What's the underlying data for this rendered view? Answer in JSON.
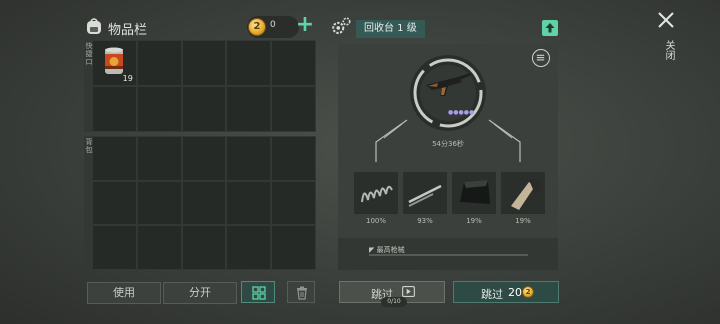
{
  "inventory": {
    "title": "物品栏",
    "coin_balance": "0",
    "coin_symbol": "2",
    "quick_slot_label": "快捷口",
    "backpack_label": "背包",
    "slot_item": {
      "name": "canned food",
      "count": "19"
    }
  },
  "actions": {
    "use_label": "使用",
    "split_label": "分开"
  },
  "recycler": {
    "title": "回收台 1 级",
    "timer": "54分36秒",
    "materials": [
      {
        "name": "spring",
        "percent": "100%"
      },
      {
        "name": "metal-rod",
        "percent": "93%"
      },
      {
        "name": "metal-plate",
        "percent": "19%"
      },
      {
        "name": "wood-handle",
        "percent": "19%"
      }
    ],
    "progress_label": "最高枪械",
    "progress": 0
  },
  "skip": {
    "ad_label": "跳过",
    "ad_counter": "0/10",
    "pay_label": "跳过",
    "pay_cost": "20"
  },
  "close": {
    "label": "关闭"
  },
  "colors": {
    "accent": "#5fd3a6",
    "coin": "#e2a92a",
    "panel": "#343834",
    "title_bg": "#355a56"
  }
}
